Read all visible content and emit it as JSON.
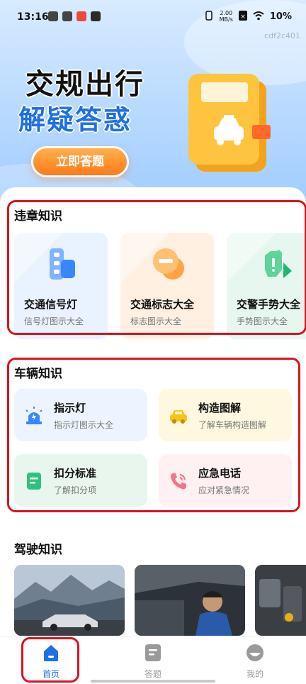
{
  "status_bar": {
    "time": "13:16",
    "net_speed_top": "2.00",
    "net_speed_bottom": "MB/s",
    "battery": "10%"
  },
  "watermark": "cdf2c401",
  "hero": {
    "line1": "交规出行",
    "line2": "解疑答惑",
    "cta": "立即答题"
  },
  "violation": {
    "title": "违章知识",
    "cards": [
      {
        "title": "交通信号灯",
        "subtitle": "信号灯图示大全",
        "icon": "traffic-light-icon",
        "color": "#e9f2ff"
      },
      {
        "title": "交通标志大全",
        "subtitle": "标志图示大全",
        "icon": "traffic-sign-icon",
        "color": "#fff0e2"
      },
      {
        "title": "交警手势大全",
        "subtitle": "手势图示大全",
        "icon": "hand-gesture-icon",
        "color": "#e6f7ef"
      }
    ]
  },
  "vehicle": {
    "title": "车辆知识",
    "cards": [
      {
        "title": "指示灯",
        "subtitle": "指示灯图示大全",
        "icon": "warning-light-icon",
        "color": "#eef4ff"
      },
      {
        "title": "构造图解",
        "subtitle": "了解车辆构造图解",
        "icon": "car-icon",
        "color": "#fff8e0"
      },
      {
        "title": "扣分标准",
        "subtitle": "了解扣分项",
        "icon": "document-icon",
        "color": "#e8f6ee"
      },
      {
        "title": "应急电话",
        "subtitle": "应对紧急情况",
        "icon": "phone-icon",
        "color": "#fff0f2"
      }
    ]
  },
  "driving": {
    "title": "驾驶知识"
  },
  "nav": {
    "items": [
      {
        "label": "首页",
        "icon": "home-icon"
      },
      {
        "label": "答题",
        "icon": "quiz-icon"
      },
      {
        "label": "我的",
        "icon": "profile-icon"
      }
    ],
    "active_color": "#1f6fe6",
    "inactive_color": "#9a9a9a"
  }
}
